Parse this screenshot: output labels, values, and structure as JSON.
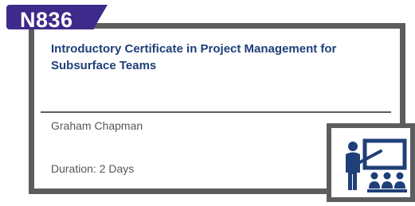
{
  "course": {
    "code": "N836",
    "title": "Introductory Certificate in Project Management for Subsurface Teams",
    "presenter": "Graham Chapman",
    "duration": "Duration: 2 Days"
  },
  "icon": {
    "name": "classroom-presentation-icon",
    "color": "#1f3f78"
  },
  "colors": {
    "tab": "#3e2a8a",
    "frame": "#5b5d5f",
    "title": "#1f3f78",
    "text": "#555759"
  }
}
